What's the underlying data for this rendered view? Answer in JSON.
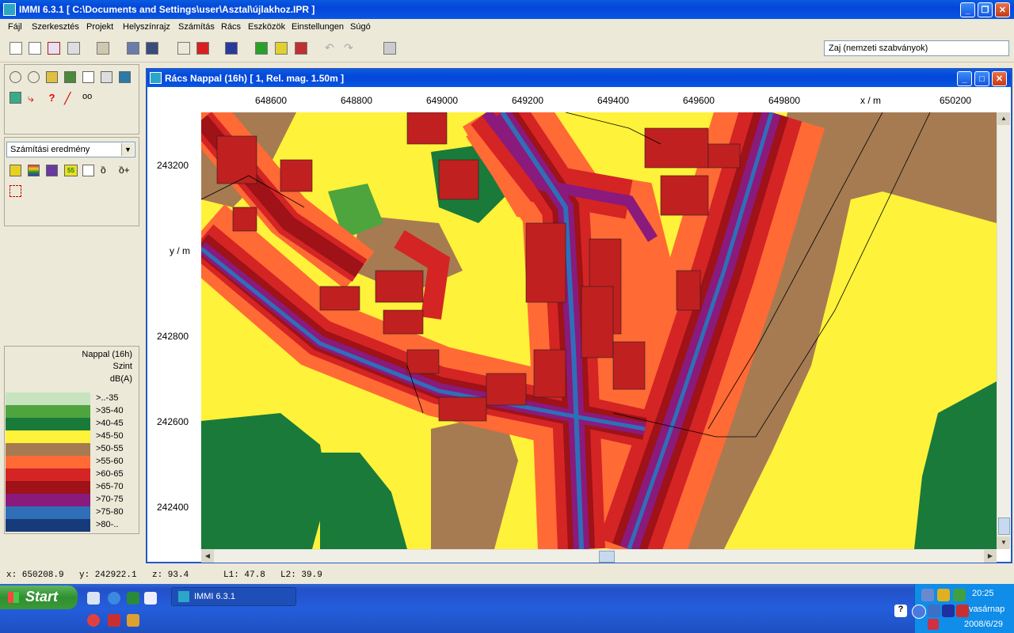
{
  "window": {
    "title": "IMMI 6.3.1 [ C:\\Documents and Settings\\user\\Asztal\\újlakhoz.IPR ]",
    "min": "_",
    "max": "❐",
    "close": "✕"
  },
  "menu": [
    "Fájl",
    "Szerkesztés",
    "Projekt",
    "Helyszínrajz",
    "Számítás",
    "Rács",
    "Eszközök",
    "Einstellungen",
    "Súgó"
  ],
  "toolbar": {
    "noise_select_value": "Zaj (nemzeti szabványok)"
  },
  "left_panel": {
    "calc_select_value": "Számítási eredmény",
    "legend": {
      "title": "Nappal (16h)",
      "subtitle": "Szint",
      "unit": "dB(A)",
      "levels": [
        {
          "label": ">..-35",
          "color": "#c7e3bf"
        },
        {
          "label": ">35-40",
          "color": "#4ea53e"
        },
        {
          "label": ">40-45",
          "color": "#1a7a3a"
        },
        {
          "label": ">45-50",
          "color": "#fff23a"
        },
        {
          "label": ">50-55",
          "color": "#a67b52"
        },
        {
          "label": ">55-60",
          "color": "#ff6a35"
        },
        {
          "label": ">60-65",
          "color": "#d42424"
        },
        {
          "label": ">65-70",
          "color": "#9e1218"
        },
        {
          "label": ">70-75",
          "color": "#8a1a7c"
        },
        {
          "label": ">75-80",
          "color": "#2f6fb8"
        },
        {
          "label": ">80-..",
          "color": "#163a7a"
        }
      ]
    }
  },
  "child_window": {
    "title": "Rács Nappal (16h)  [ 1, Rel. mag.  1.50m ]",
    "x_ticks": [
      "648600",
      "648800",
      "649000",
      "649200",
      "649400",
      "649600",
      "649800",
      "650200"
    ],
    "x_axis_label": "x / m",
    "y_ticks": [
      "243200",
      "242800",
      "242600",
      "242400"
    ],
    "y_axis_label": "y / m"
  },
  "status": {
    "x": "x: 650208.9",
    "y": "y: 242922.1",
    "z": "z:   93.4",
    "l1": "L1: 47.8",
    "l2": "L2: 39.9"
  },
  "taskbar": {
    "start": "Start",
    "app": "IMMI 6.3.1",
    "time": "20:25",
    "day": "vasárnap",
    "date": "2008/6/29"
  }
}
